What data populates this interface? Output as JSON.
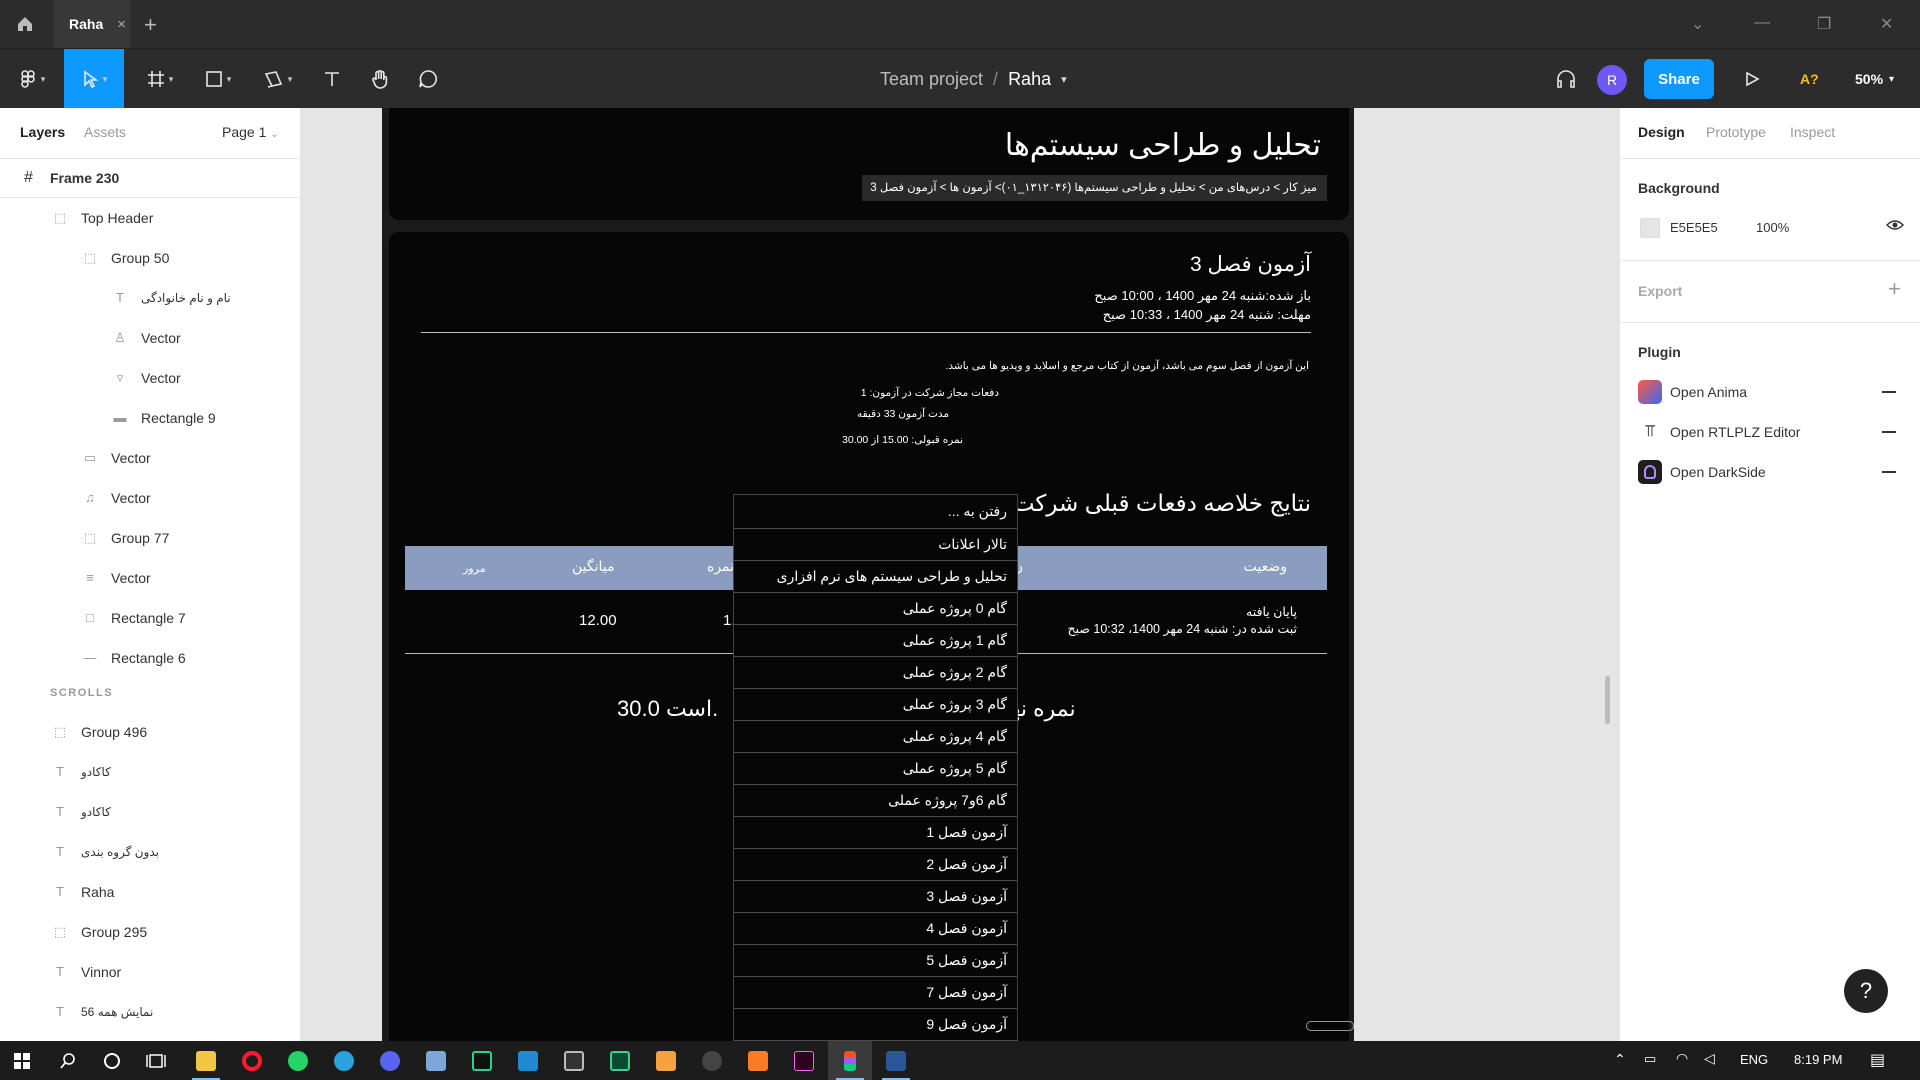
{
  "app": {
    "tab_title": "Raha",
    "tab_close": "×",
    "new_tab": "+"
  },
  "toolbar": {
    "project": "Team project",
    "separator": "/",
    "file_name": "Raha",
    "avatar_initial": "R",
    "share_label": "Share",
    "a11y_label": "A?",
    "zoom_label": "50%"
  },
  "left_panel": {
    "tabs": [
      "Layers",
      "Assets"
    ],
    "page_selector": "Page 1",
    "frame_name": "Frame 230",
    "layers": [
      {
        "label": "Top Header",
        "icon": "⬚"
      },
      {
        "label": "Group 50",
        "icon": "⬚"
      },
      {
        "label": "نام و نام خانوادگی",
        "icon": "T"
      },
      {
        "label": "Vector",
        "icon": "♙"
      },
      {
        "label": "Vector",
        "icon": "▿"
      },
      {
        "label": "Rectangle 9",
        "icon": "▬"
      },
      {
        "label": "Vector",
        "icon": "▭"
      },
      {
        "label": "Vector",
        "icon": "♫"
      },
      {
        "label": "Group 77",
        "icon": "⬚"
      },
      {
        "label": "Vector",
        "icon": "≡"
      },
      {
        "label": "Rectangle 7",
        "icon": "□"
      },
      {
        "label": "Rectangle 6",
        "icon": "—"
      }
    ],
    "section_label": "SCROLLS",
    "scroll_layers": [
      {
        "label": "Group 496",
        "icon": "⬚"
      },
      {
        "label": "کاکادو",
        "icon": "T"
      },
      {
        "label": "کاکادو",
        "icon": "T"
      },
      {
        "label": "بدون گروه بندی",
        "icon": "T"
      },
      {
        "label": "Raha",
        "icon": "T"
      },
      {
        "label": "Group 295",
        "icon": "⬚"
      },
      {
        "label": "Vinnor",
        "icon": "T"
      },
      {
        "label": "نمایش همه 56",
        "icon": "T"
      }
    ]
  },
  "canvas": {
    "page_title": "تحلیل و طراحی سیستم‌ها",
    "breadcrumb": "میز کار > درس‌های من > تحلیل و طراحی سیستم‌ها (۱۳۱۲۰۴۶_۰۱)> آزمون ها > آزمون فصل 3",
    "quiz_title": "آزمون فصل 3",
    "opened": "باز شده:شنبه 24 مهر 1400 ، 10:00 صبح",
    "due": "مهلت: شنبه 24 مهر 1400 ، 10:33 صبح",
    "description": "این آزمون از فصل سوم می باشد، آزمون از کتاب مرجع و اسلاید و ویدیو ها می باشد.",
    "attempts": "دفعات مجاز شرکت در آزمون: 1",
    "duration": "مدت آزمون 33 دقیقه",
    "passing": "نمره قبولی: 15.00 از 30.00",
    "summary_title": "نتایج خلاصه دفعات قبلی شرکت",
    "table": {
      "headers": {
        "status": "وضعیت",
        "grade": "نمره",
        "average": "میانگین",
        "review": "مرور",
        "partial": "ن"
      },
      "row": {
        "status": "پایان یافته",
        "submitted": "ثبت شده در: شنبه 24 مهر 1400، 10:32 صبح",
        "grade": "1.",
        "average": "12.00"
      }
    },
    "final_grade_left": "30.0 است.",
    "final_grade_right": "نمره نها"
  },
  "dropdown": {
    "items": [
      "رفتن به ...",
      "تالار اعلانات",
      "تحلیل و طراحی سیستم های نرم افزاری",
      "گام 0 پروژه عملی",
      "گام 1 پروژه عملی",
      "گام 2 پروژه عملی",
      "گام 3 پروژه عملی",
      "گام 4 پروژه عملی",
      "گام 5 پروژه عملی",
      "گام 6و7 پروژه عملی",
      "آزمون فصل 1",
      "آزمون فصل 2",
      "آزمون فصل 3",
      "آزمون فصل 4",
      "آزمون فصل 5",
      "آزمون فصل 7",
      "آزمون فصل 9"
    ]
  },
  "right_panel": {
    "tabs": [
      "Design",
      "Prototype",
      "Inspect"
    ],
    "background_label": "Background",
    "bg_hex": "E5E5E5",
    "bg_opacity": "100%",
    "export_label": "Export",
    "plugin_label": "Plugin",
    "plugins": [
      "Open Anima",
      "Open RTLPLZ Editor",
      "Open DarkSide"
    ],
    "help": "?"
  },
  "taskbar": {
    "lang": "ENG",
    "time": "8:19 PM"
  },
  "colors": {
    "accent": "#0d99ff",
    "toolbar_bg": "#2c2c2c",
    "canvas_bg": "#e5e5e5",
    "table_header": "#8a9cc0"
  }
}
